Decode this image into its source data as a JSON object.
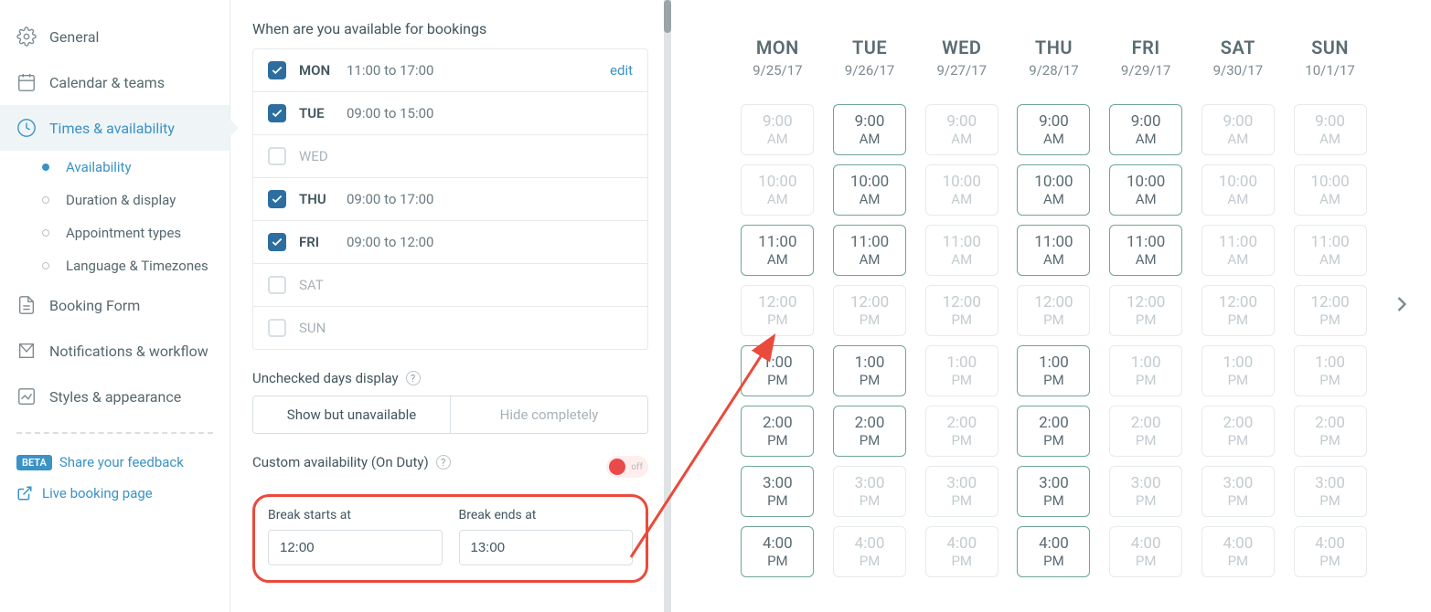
{
  "sidebar": {
    "items": [
      {
        "label": "General",
        "icon": "gear"
      },
      {
        "label": "Calendar & teams",
        "icon": "calendar-teams"
      },
      {
        "label": "Times & availability",
        "icon": "clock",
        "active": true
      },
      {
        "label": "Booking Form",
        "icon": "form"
      },
      {
        "label": "Notifications & workflow",
        "icon": "mail"
      },
      {
        "label": "Styles & appearance",
        "icon": "chart"
      }
    ],
    "sub": [
      {
        "label": "Availability",
        "active": true
      },
      {
        "label": "Duration & display"
      },
      {
        "label": "Appointment types"
      },
      {
        "label": "Language & Timezones"
      }
    ],
    "footer": {
      "beta": "BETA",
      "feedback": "Share your feedback",
      "live": "Live booking page"
    }
  },
  "settings": {
    "heading": "When are you available for bookings",
    "days": [
      {
        "abbr": "MON",
        "checked": true,
        "hours": "11:00 to 17:00",
        "edit": "edit"
      },
      {
        "abbr": "TUE",
        "checked": true,
        "hours": "09:00 to 15:00"
      },
      {
        "abbr": "WED",
        "checked": false
      },
      {
        "abbr": "THU",
        "checked": true,
        "hours": "09:00 to 17:00"
      },
      {
        "abbr": "FRI",
        "checked": true,
        "hours": "09:00 to 12:00"
      },
      {
        "abbr": "SAT",
        "checked": false
      },
      {
        "abbr": "SUN",
        "checked": false
      }
    ],
    "unchecked_label": "Unchecked days display",
    "unchecked_options": [
      "Show but unavailable",
      "Hide completely"
    ],
    "custom_label": "Custom availability (On Duty)",
    "custom_state": "off",
    "break_start_label": "Break starts at",
    "break_start_value": "12:00",
    "break_end_label": "Break ends at",
    "break_end_value": "13:00"
  },
  "calendar": {
    "days": [
      {
        "dow": "MON",
        "date": "9/25/17",
        "slots": [
          {
            "t": "9:00",
            "ap": "AM",
            "a": false
          },
          {
            "t": "10:00",
            "ap": "AM",
            "a": false
          },
          {
            "t": "11:00",
            "ap": "AM",
            "a": true
          },
          {
            "t": "12:00",
            "ap": "PM",
            "a": false
          },
          {
            "t": "1:00",
            "ap": "PM",
            "a": true
          },
          {
            "t": "2:00",
            "ap": "PM",
            "a": true
          },
          {
            "t": "3:00",
            "ap": "PM",
            "a": true
          },
          {
            "t": "4:00",
            "ap": "PM",
            "a": true
          }
        ]
      },
      {
        "dow": "TUE",
        "date": "9/26/17",
        "slots": [
          {
            "t": "9:00",
            "ap": "AM",
            "a": true
          },
          {
            "t": "10:00",
            "ap": "AM",
            "a": true
          },
          {
            "t": "11:00",
            "ap": "AM",
            "a": true
          },
          {
            "t": "12:00",
            "ap": "PM",
            "a": false
          },
          {
            "t": "1:00",
            "ap": "PM",
            "a": true
          },
          {
            "t": "2:00",
            "ap": "PM",
            "a": true
          },
          {
            "t": "3:00",
            "ap": "PM",
            "a": false
          },
          {
            "t": "4:00",
            "ap": "PM",
            "a": false
          }
        ]
      },
      {
        "dow": "WED",
        "date": "9/27/17",
        "slots": [
          {
            "t": "9:00",
            "ap": "AM",
            "a": false
          },
          {
            "t": "10:00",
            "ap": "AM",
            "a": false
          },
          {
            "t": "11:00",
            "ap": "AM",
            "a": false
          },
          {
            "t": "12:00",
            "ap": "PM",
            "a": false
          },
          {
            "t": "1:00",
            "ap": "PM",
            "a": false
          },
          {
            "t": "2:00",
            "ap": "PM",
            "a": false
          },
          {
            "t": "3:00",
            "ap": "PM",
            "a": false
          },
          {
            "t": "4:00",
            "ap": "PM",
            "a": false
          }
        ]
      },
      {
        "dow": "THU",
        "date": "9/28/17",
        "slots": [
          {
            "t": "9:00",
            "ap": "AM",
            "a": true
          },
          {
            "t": "10:00",
            "ap": "AM",
            "a": true
          },
          {
            "t": "11:00",
            "ap": "AM",
            "a": true
          },
          {
            "t": "12:00",
            "ap": "PM",
            "a": false
          },
          {
            "t": "1:00",
            "ap": "PM",
            "a": true
          },
          {
            "t": "2:00",
            "ap": "PM",
            "a": true
          },
          {
            "t": "3:00",
            "ap": "PM",
            "a": true
          },
          {
            "t": "4:00",
            "ap": "PM",
            "a": true
          }
        ]
      },
      {
        "dow": "FRI",
        "date": "9/29/17",
        "slots": [
          {
            "t": "9:00",
            "ap": "AM",
            "a": true
          },
          {
            "t": "10:00",
            "ap": "AM",
            "a": true
          },
          {
            "t": "11:00",
            "ap": "AM",
            "a": true
          },
          {
            "t": "12:00",
            "ap": "PM",
            "a": false
          },
          {
            "t": "1:00",
            "ap": "PM",
            "a": false
          },
          {
            "t": "2:00",
            "ap": "PM",
            "a": false
          },
          {
            "t": "3:00",
            "ap": "PM",
            "a": false
          },
          {
            "t": "4:00",
            "ap": "PM",
            "a": false
          }
        ]
      },
      {
        "dow": "SAT",
        "date": "9/30/17",
        "slots": [
          {
            "t": "9:00",
            "ap": "AM",
            "a": false
          },
          {
            "t": "10:00",
            "ap": "AM",
            "a": false
          },
          {
            "t": "11:00",
            "ap": "AM",
            "a": false
          },
          {
            "t": "12:00",
            "ap": "PM",
            "a": false
          },
          {
            "t": "1:00",
            "ap": "PM",
            "a": false
          },
          {
            "t": "2:00",
            "ap": "PM",
            "a": false
          },
          {
            "t": "3:00",
            "ap": "PM",
            "a": false
          },
          {
            "t": "4:00",
            "ap": "PM",
            "a": false
          }
        ]
      },
      {
        "dow": "SUN",
        "date": "10/1/17",
        "slots": [
          {
            "t": "9:00",
            "ap": "AM",
            "a": false
          },
          {
            "t": "10:00",
            "ap": "AM",
            "a": false
          },
          {
            "t": "11:00",
            "ap": "AM",
            "a": false
          },
          {
            "t": "12:00",
            "ap": "PM",
            "a": false
          },
          {
            "t": "1:00",
            "ap": "PM",
            "a": false
          },
          {
            "t": "2:00",
            "ap": "PM",
            "a": false
          },
          {
            "t": "3:00",
            "ap": "PM",
            "a": false
          },
          {
            "t": "4:00",
            "ap": "PM",
            "a": false
          }
        ]
      }
    ]
  }
}
